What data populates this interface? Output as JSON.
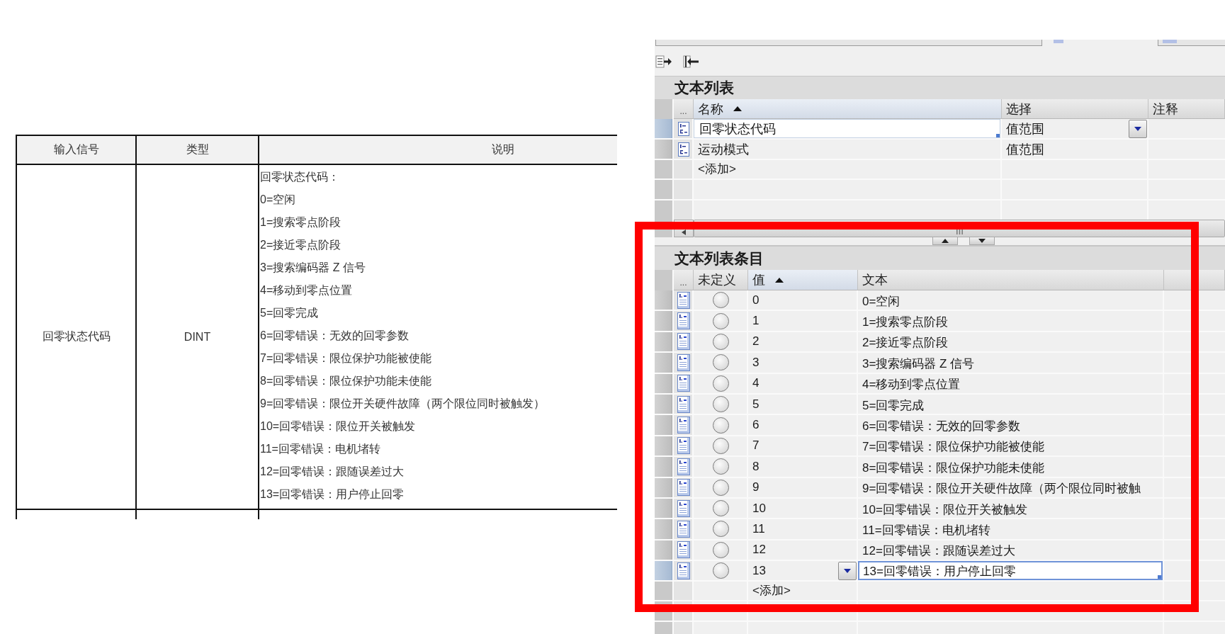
{
  "spec_table": {
    "columns": [
      "输入信号",
      "类型",
      "说明"
    ],
    "rows": [
      {
        "signal": "回零状态代码",
        "type": "DINT",
        "description": [
          "回零状态代码：",
          "0=空闲",
          "1=搜索零点阶段",
          "2=接近零点阶段",
          "3=搜索编码器 Z 信号",
          "4=移动到零点位置",
          "5=回零完成",
          "6=回零错误：无效的回零参数",
          "7=回零错误：限位保护功能被使能",
          "8=回零错误：限位保护功能未使能",
          "9=回零错误：限位开关硬件故障（两个限位同时被触发）",
          "10=回零错误：限位开关被触发",
          "11=回零错误：电机堵转",
          "12=回零错误：跟随误差过大",
          "13=回零错误：用户停止回零"
        ]
      }
    ]
  },
  "editor": {
    "text_lists": {
      "title": "文本列表",
      "columns": [
        {
          "label": "...",
          "sorted": false
        },
        {
          "label": "名称",
          "sorted": true
        },
        {
          "label": "选择",
          "sorted": false
        },
        {
          "label": "注释",
          "sorted": false
        }
      ],
      "rows": [
        {
          "name": "回零状态代码",
          "selection": "值范围",
          "selected": true
        },
        {
          "name": "运动模式",
          "selection": "值范围",
          "selected": false
        }
      ],
      "add_label": "<添加>"
    },
    "entries": {
      "title": "文本列表条目",
      "columns": [
        {
          "label": "...",
          "sorted": false
        },
        {
          "label": "未定义",
          "sorted": false
        },
        {
          "label": "值",
          "sorted": true
        },
        {
          "label": "文本",
          "sorted": false
        }
      ],
      "rows": [
        {
          "checked": false,
          "value": "0",
          "text": "0=空闲",
          "selected": false
        },
        {
          "checked": false,
          "value": "1",
          "text": "1=搜索零点阶段",
          "selected": false
        },
        {
          "checked": false,
          "value": "2",
          "text": "2=接近零点阶段",
          "selected": false
        },
        {
          "checked": false,
          "value": "3",
          "text": "3=搜索编码器 Z 信号",
          "selected": false
        },
        {
          "checked": false,
          "value": "4",
          "text": "4=移动到零点位置",
          "selected": false
        },
        {
          "checked": false,
          "value": "5",
          "text": "5=回零完成",
          "selected": false
        },
        {
          "checked": false,
          "value": "6",
          "text": "6=回零错误：无效的回零参数",
          "selected": false
        },
        {
          "checked": false,
          "value": "7",
          "text": "7=回零错误：限位保护功能被使能",
          "selected": false
        },
        {
          "checked": false,
          "value": "8",
          "text": "8=回零错误：限位保护功能未使能",
          "selected": false
        },
        {
          "checked": false,
          "value": "9",
          "text": "9=回零错误：限位开关硬件故障（两个限位同时被触",
          "selected": false
        },
        {
          "checked": false,
          "value": "10",
          "text": "10=回零错误：限位开关被触发",
          "selected": false
        },
        {
          "checked": false,
          "value": "11",
          "text": "11=回零错误：电机堵转",
          "selected": false
        },
        {
          "checked": false,
          "value": "12",
          "text": "12=回零错误：跟随误差过大",
          "selected": false
        },
        {
          "checked": false,
          "value": "13",
          "text": "13=回零错误：用户停止回零",
          "selected": true
        }
      ],
      "add_label": "<添加>"
    }
  }
}
